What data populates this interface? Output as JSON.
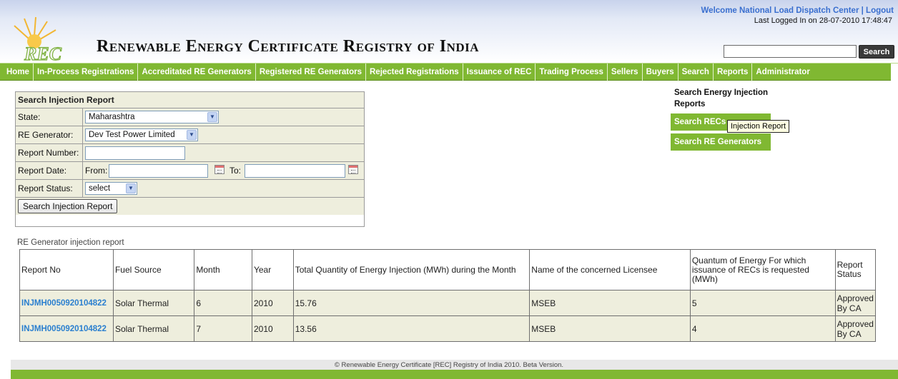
{
  "header": {
    "site_title": "Renewable Energy Certificate Registry of India",
    "welcome_text": "Welcome National Load Dispatch Center",
    "separator": "|",
    "logout_label": "Logout",
    "last_login": "Last Logged In on 28-07-2010 17:48:47",
    "logo_text": "REC",
    "search_value": "",
    "search_button": "Search"
  },
  "nav": {
    "items": [
      "Home",
      "In-Process Registrations",
      "Accreditated RE Generators",
      "Registered RE Generators",
      "Rejected Registrations",
      "Issuance of REC",
      "Trading Process",
      "Sellers",
      "Buyers",
      "Search",
      "Reports",
      "Administrator"
    ]
  },
  "form": {
    "title": "Search Injection Report",
    "state_label": "State:",
    "state_value": "Maharashtra",
    "generator_label": "RE Generator:",
    "generator_value": "Dev Test Power Limited",
    "report_number_label": "Report Number:",
    "report_number_value": "",
    "report_date_label": "Report Date:",
    "from_label": "From:",
    "to_label": "To:",
    "from_value": "",
    "to_value": "",
    "status_label": "Report Status:",
    "status_value": "select",
    "submit_label": "Search Injection Report"
  },
  "side": {
    "title": "Search Energy Injection Reports",
    "buttons": [
      "Search RECs",
      "Search RE Generators"
    ],
    "tooltip": "Injection Report"
  },
  "results": {
    "caption": "RE Generator injection report",
    "headers": [
      "Report No",
      "Fuel Source",
      "Month",
      "Year",
      "Total Quantity of Energy Injection (MWh) during the Month",
      "Name of the concerned Licensee",
      "Quantum of Energy For which issuance of RECs is requested (MWh)",
      "Report Status"
    ],
    "rows": [
      [
        "INJMH0050920104822",
        "Solar Thermal",
        "6",
        "2010",
        "15.76",
        "MSEB",
        "5",
        "Approved By CA"
      ],
      [
        "INJMH0050920104822",
        "Solar Thermal",
        "7",
        "2010",
        "13.56",
        "MSEB",
        "4",
        "Approved By CA"
      ]
    ]
  },
  "footer": {
    "text": "© Renewable Energy Certificate [REC] Registry of India 2010. Beta Version."
  },
  "colors": {
    "nav_green": "#80b832",
    "form_bg": "#eeeedd",
    "link_blue": "#2a7fcf",
    "welcome_blue": "#3a6fcf"
  }
}
